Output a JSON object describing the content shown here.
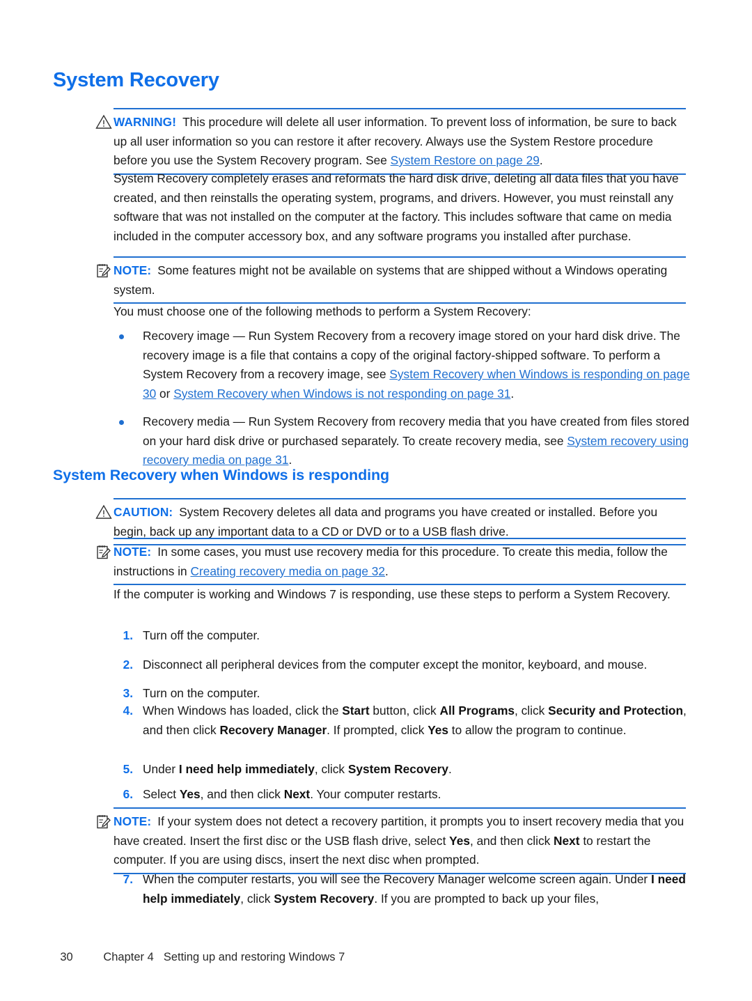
{
  "document": {
    "title": "System Recovery",
    "accent_color": "#0f6fe8",
    "link_color": "#1f6fd0",
    "rule_color": "#1f6fd0",
    "body_color": "#1a1a1a"
  },
  "headings": {
    "h1": "System Recovery",
    "h2": "System Recovery when Windows is responding"
  },
  "warning_box": {
    "icon": "warning-triangle-icon",
    "label": "WARNING!",
    "text_before_link": "This procedure will delete all user information. To prevent loss of information, be sure to back up all user information so you can restore it after recovery. Always use the System Restore procedure before you use the System Recovery program. See ",
    "link": "System Restore on page 29",
    "text_after_link": "."
  },
  "intro_paragraph": "System Recovery completely erases and reformats the hard disk drive, deleting all data files that you have created, and then reinstalls the operating system, programs, and drivers. However, you must reinstall any software that was not installed on the computer at the factory. This includes software that came on media included in the computer accessory box, and any software programs you installed after purchase.",
  "note_box_1": {
    "icon": "note-pad-icon",
    "label": "NOTE:",
    "text": "Some features might not be available on systems that are shipped without a Windows operating system."
  },
  "methods_lead_in": "You must choose one of the following methods to perform a System Recovery:",
  "bullets": [
    {
      "bullet": "bullet-dot",
      "text_1": "Recovery image — Run System Recovery from a recovery image stored on your hard disk drive. The recovery image is a file that contains a copy of the original factory-shipped software. To perform a System Recovery from a recovery image, see ",
      "link_1": "System Recovery when Windows is responding on page 30",
      "text_2": " or ",
      "link_2": "System Recovery when Windows is not responding on page 31",
      "text_3": "."
    },
    {
      "bullet": "bullet-dot",
      "text_1": "Recovery media — Run System Recovery from recovery media that you have created from files stored on your hard disk drive or purchased separately. To create recovery media, see ",
      "link_1": "System recovery using recovery media on page 31",
      "text_2": "",
      "link_2": "",
      "text_3": "."
    }
  ],
  "caution_box": {
    "icon": "warning-triangle-icon",
    "label": "CAUTION:",
    "text": "System Recovery deletes all data and programs you have created or installed. Before you begin, back up any important data to a CD or DVD or to a USB flash drive."
  },
  "note_box_2": {
    "icon": "note-pad-icon",
    "label": "NOTE:",
    "text_before_link": "In some cases, you must use recovery media for this procedure. To create this media, follow the instructions in ",
    "link": "Creating recovery media on page 32",
    "text_after_link": "."
  },
  "steps_lead_in": "If the computer is working and Windows 7 is responding, use these steps to perform a System Recovery.",
  "steps_group_1": [
    {
      "num": "1.",
      "text": "Turn off the computer."
    },
    {
      "num": "2.",
      "text": "Disconnect all peripheral devices from the computer except the monitor, keyboard, and mouse."
    },
    {
      "num": "3.",
      "text": "Turn on the computer."
    }
  ],
  "step_4": {
    "num": "4.",
    "p1": "When Windows has loaded, click the ",
    "b1": "Start",
    "p2": " button, click ",
    "b2": "All Programs",
    "p3": ", click ",
    "b3": "Security and Protection",
    "p4": ", and then click ",
    "b4": "Recovery Manager",
    "p5": ". If prompted, click ",
    "b5": "Yes",
    "p6": " to allow the program to continue."
  },
  "step_5": {
    "num": "5.",
    "p1": "Under ",
    "b1": "I need help immediately",
    "p2": ", click ",
    "b2": "System Recovery",
    "p3": "."
  },
  "step_6": {
    "num": "6.",
    "p1": "Select ",
    "b1": "Yes",
    "p2": ", and then click ",
    "b2": "Next",
    "p3": ". Your computer restarts."
  },
  "note_box_3": {
    "icon": "note-pad-icon",
    "label": "NOTE:",
    "p1": "If your system does not detect a recovery partition, it prompts you to insert recovery media that you have created. Insert the first disc or the USB flash drive, select ",
    "b1": "Yes",
    "p2": ", and then click ",
    "b2": "Next",
    "p3": " to restart the computer. If you are using discs, insert the next disc when prompted."
  },
  "step_7": {
    "num": "7.",
    "p1": "When the computer restarts, you will see the Recovery Manager welcome screen again. Under ",
    "b1": "I need help immediately",
    "p2": ", click ",
    "b2": "System Recovery",
    "p3": ". If you are prompted to back up your files,"
  },
  "footer": {
    "page_number": "30",
    "chapter": "Chapter 4",
    "chapter_title": "Setting up and restoring Windows 7"
  }
}
